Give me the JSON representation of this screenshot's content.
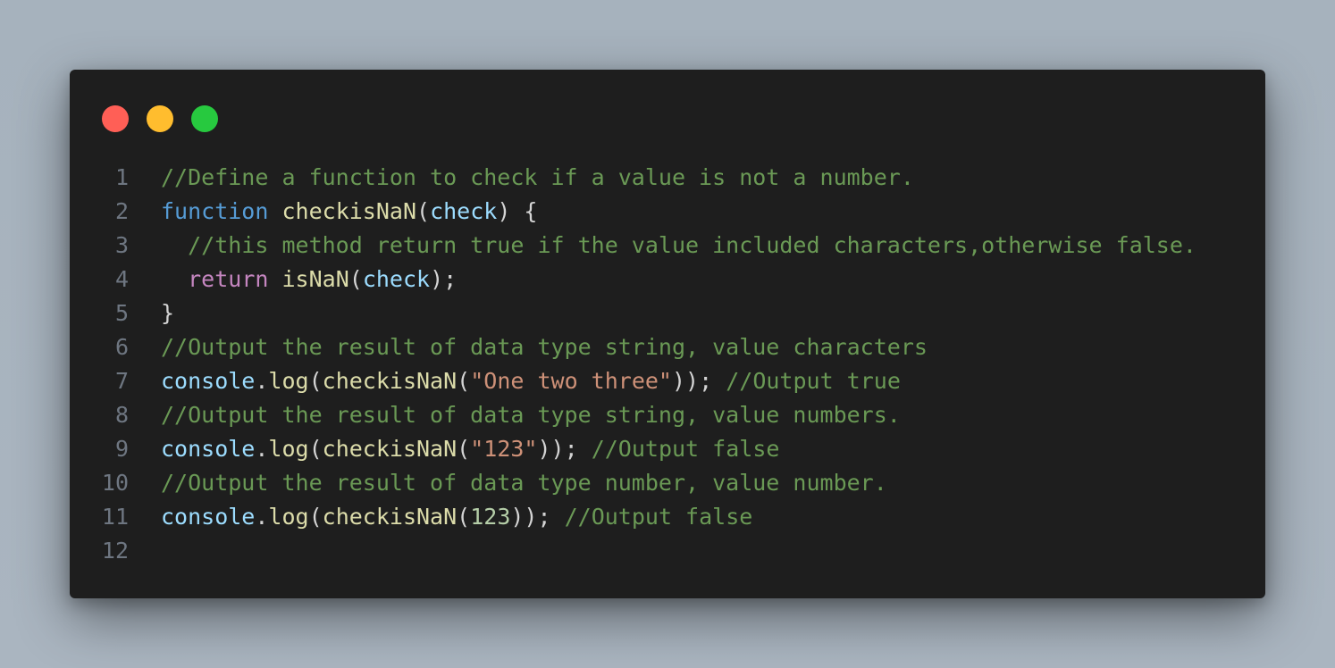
{
  "window": {
    "controls": [
      {
        "name": "close",
        "color": "#ff5f56"
      },
      {
        "name": "minimize",
        "color": "#ffbd2e"
      },
      {
        "name": "maximize",
        "color": "#27c93f"
      }
    ]
  },
  "theme": {
    "background": "#1e1e1e",
    "comment": "#6a9955",
    "keyword": "#569cd6",
    "control": "#c586c0",
    "function": "#dcdcaa",
    "variable": "#9cdcfe",
    "string": "#ce9178",
    "number": "#b5cea8",
    "text": "#d4d4d4",
    "line_number": "#6e7681"
  },
  "code": {
    "lines": [
      {
        "n": "1",
        "tokens": [
          [
            "comment",
            "//Define a function to check if a value is not a number."
          ]
        ]
      },
      {
        "n": "2",
        "tokens": [
          [
            "keyword",
            "function"
          ],
          [
            "punct",
            " "
          ],
          [
            "func",
            "checkisNaN"
          ],
          [
            "punct",
            "("
          ],
          [
            "param",
            "check"
          ],
          [
            "punct",
            ") {"
          ]
        ]
      },
      {
        "n": "3",
        "tokens": [
          [
            "punct",
            "  "
          ],
          [
            "comment",
            "//this method return true if the value included characters,otherwise false."
          ]
        ]
      },
      {
        "n": "4",
        "tokens": [
          [
            "punct",
            "  "
          ],
          [
            "control",
            "return"
          ],
          [
            "punct",
            " "
          ],
          [
            "func",
            "isNaN"
          ],
          [
            "punct",
            "("
          ],
          [
            "param",
            "check"
          ],
          [
            "punct",
            ");"
          ]
        ]
      },
      {
        "n": "5",
        "tokens": [
          [
            "punct",
            "}"
          ]
        ]
      },
      {
        "n": "6",
        "tokens": [
          [
            "comment",
            "//Output the result of data type string, value characters"
          ]
        ]
      },
      {
        "n": "7",
        "tokens": [
          [
            "var",
            "console"
          ],
          [
            "punct",
            "."
          ],
          [
            "func",
            "log"
          ],
          [
            "punct",
            "("
          ],
          [
            "func",
            "checkisNaN"
          ],
          [
            "punct",
            "("
          ],
          [
            "string",
            "\"One two three\""
          ],
          [
            "punct",
            ")); "
          ],
          [
            "comment",
            "//Output true"
          ]
        ]
      },
      {
        "n": "8",
        "tokens": [
          [
            "comment",
            "//Output the result of data type string, value numbers."
          ]
        ]
      },
      {
        "n": "9",
        "tokens": [
          [
            "var",
            "console"
          ],
          [
            "punct",
            "."
          ],
          [
            "func",
            "log"
          ],
          [
            "punct",
            "("
          ],
          [
            "func",
            "checkisNaN"
          ],
          [
            "punct",
            "("
          ],
          [
            "string",
            "\"123\""
          ],
          [
            "punct",
            ")); "
          ],
          [
            "comment",
            "//Output false"
          ]
        ]
      },
      {
        "n": "10",
        "tokens": [
          [
            "comment",
            "//Output the result of data type number, value number."
          ]
        ]
      },
      {
        "n": "11",
        "tokens": [
          [
            "var",
            "console"
          ],
          [
            "punct",
            "."
          ],
          [
            "func",
            "log"
          ],
          [
            "punct",
            "("
          ],
          [
            "func",
            "checkisNaN"
          ],
          [
            "punct",
            "("
          ],
          [
            "number",
            "123"
          ],
          [
            "punct",
            ")); "
          ],
          [
            "comment",
            "//Output false"
          ]
        ]
      },
      {
        "n": "12",
        "tokens": []
      }
    ]
  }
}
